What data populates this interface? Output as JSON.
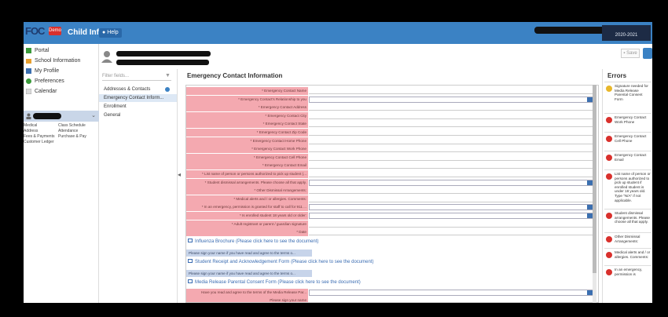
{
  "app": {
    "title": "Child Info",
    "help_label": "Help",
    "school_year": "2020-2021",
    "logo_text": "FOC",
    "logo_badge": "Demo"
  },
  "nav": {
    "items": [
      {
        "label": "Portal"
      },
      {
        "label": "School Information"
      },
      {
        "label": "My Profile"
      },
      {
        "label": "Preferences"
      },
      {
        "label": "Calendar"
      }
    ],
    "sub_links": [
      [
        "Medical",
        "Class Schedule"
      ],
      [
        "Address",
        "Attendance"
      ],
      [
        "Fees & Payments",
        "Purchase & Pay"
      ],
      [
        "Customer Ledger",
        ""
      ]
    ]
  },
  "header": {
    "save_label": "Save"
  },
  "fields_panel": {
    "filter_placeholder": "Filter fields...",
    "items": [
      {
        "label": "Addresses & Contacts"
      },
      {
        "label": "Emergency Contact Inform..."
      },
      {
        "label": "Enrollment"
      },
      {
        "label": "General"
      }
    ]
  },
  "form": {
    "title": "Emergency Contact Information",
    "rows": [
      {
        "label": "* Emergency Contact Name",
        "type": "text"
      },
      {
        "label": "* Emergency Contact's Relationship to you",
        "type": "select"
      },
      {
        "label": "* Emergency Contact Address",
        "type": "text"
      },
      {
        "label": "* Emergency Contact City",
        "type": "text"
      },
      {
        "label": "* Emergency Contact State",
        "type": "text"
      },
      {
        "label": "* Emergency Contact Zip Code",
        "type": "text"
      },
      {
        "label": "* Emergency Contact Home Phone",
        "type": "text"
      },
      {
        "label": "* Emergency Contact Work Phone",
        "type": "text"
      },
      {
        "label": "* Emergency Contact Cell Phone",
        "type": "text"
      },
      {
        "label": "* Emergency Contact Email",
        "type": "text"
      },
      {
        "label": "* List name of person or persons authorized to pick up student (...",
        "type": "text"
      },
      {
        "label": "* Student dismissal arrangements. Please choose all that apply.",
        "type": "select"
      },
      {
        "label": "* Other Dismissal Arrangements:",
        "type": "text"
      },
      {
        "label": "* Medical alerts and / or allergies. Comments:",
        "type": "text"
      },
      {
        "label": "* In an emergency, permission is granted for staff to call for 911 ...",
        "type": "select"
      },
      {
        "label": "* Is enrolled student 18 years old or older:",
        "type": "select"
      },
      {
        "label": "* Adult registrant or parent / guardian signature",
        "type": "text"
      },
      {
        "label": "* Date",
        "type": "text"
      }
    ],
    "doc1": "Influenza Brochure (Please click here to see the document)",
    "sign1": "Please sign your name if you have read and agree to the terms o...",
    "doc2": "Student Receipt and Acknowledgement Form (Please click here to see the document)",
    "sign2": "Please sign your name if you have read and agree to the terms o...",
    "doc3": "Media Release Parental Consent Form (Please click here to see the document)",
    "tail_rows": [
      {
        "label": "Have you read and agree to the terms of the Media Release Par...",
        "type": "select"
      },
      {
        "label": "Please sign your name",
        "type": "text"
      }
    ]
  },
  "errors": {
    "title": "Errors",
    "items": [
      {
        "text": "Signature needed for Media Release Parental Consent Form",
        "level": "warning"
      },
      {
        "text": "Emergency Contact Work Phone",
        "level": "error"
      },
      {
        "text": "Emergency Contact Cell Phone",
        "level": "error"
      },
      {
        "text": "Emergency Contact Email",
        "level": "error"
      },
      {
        "text": "List name of person or persons authorized to pick up student if enrolled student is under 18 years old. Type \"N/A\" if not applicable.",
        "level": "error"
      },
      {
        "text": "Student dismissal arrangements. Please choose all that apply.",
        "level": "error"
      },
      {
        "text": "Other Dismissal Arrangements:",
        "level": "error"
      },
      {
        "text": "Medical alerts and / or allergies. Comments:",
        "level": "error"
      },
      {
        "text": "In an emergency, permission is",
        "level": "error"
      }
    ]
  },
  "colors": {
    "topbar": "#3b82c4",
    "required_label": "#f4a9b0",
    "signature_row": "#c7d4ea",
    "error": "#d9302c",
    "warning": "#e8b72a"
  }
}
